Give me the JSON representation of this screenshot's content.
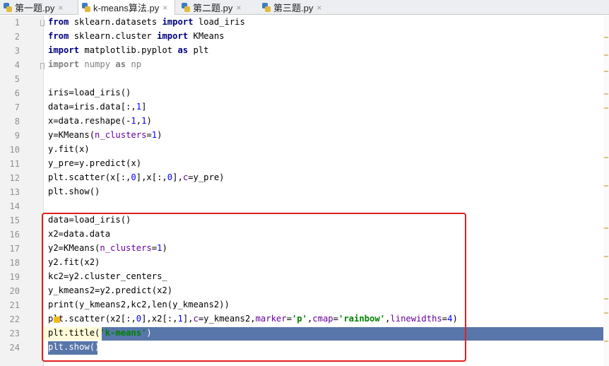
{
  "tabs": [
    {
      "label": "第一题.py",
      "active": false
    },
    {
      "label": "k-means算法.py",
      "active": true
    },
    {
      "label": "第二题.py",
      "active": false
    },
    {
      "label": "第三题.py",
      "active": false
    }
  ],
  "close_glyph": "×",
  "line_numbers": [
    "1",
    "2",
    "3",
    "4",
    "5",
    "6",
    "7",
    "8",
    "9",
    "10",
    "11",
    "12",
    "13",
    "14",
    "15",
    "16",
    "17",
    "18",
    "19",
    "20",
    "21",
    "22",
    "23",
    "24"
  ],
  "code": {
    "l1": [
      "from",
      " sklearn.datasets ",
      "import",
      " load_iris"
    ],
    "l2": [
      "from",
      " sklearn.cluster ",
      "import",
      " KMeans"
    ],
    "l3": [
      "import",
      " matplotlib.pyplot ",
      "as",
      " plt"
    ],
    "l4": [
      "import",
      " numpy ",
      "as",
      " np"
    ],
    "l6": "iris=load_iris()",
    "l7": [
      "data=iris.data[:,",
      "1",
      "]"
    ],
    "l8": [
      "x=data.reshape(-",
      "1",
      ",",
      "1",
      ")"
    ],
    "l9": [
      "y=KMeans(",
      "n_clusters",
      "=",
      "1",
      ")"
    ],
    "l10": "y.fit(x)",
    "l11": "y_pre=y.predict(x)",
    "l12": [
      "plt.scatter(x[:,",
      "0",
      "],x[:,",
      "0",
      "],",
      "c",
      "=y_pre)"
    ],
    "l13": "plt.show()",
    "l15": "data=load_iris()",
    "l16": "x2=data.data",
    "l17": [
      "y2=KMeans(",
      "n_clusters",
      "=",
      "1",
      ")"
    ],
    "l18": "y2.fit(x2)",
    "l19": "kc2=y2.cluster_centers_",
    "l20": "y_kmeans2=y2.predict(x2)",
    "l21": "print(y_kmeans2,kc2,len(y_kmeans2))",
    "l22": [
      "pl",
      "t.scatter(x2[:,",
      "0",
      "],x2[:,",
      "1",
      "],",
      "c",
      "=y_kmeans2,",
      "marker",
      "=",
      "'p'",
      ",",
      "cmap",
      "=",
      "'rainbow'",
      ",",
      "linewidths",
      "=",
      "4",
      ")"
    ],
    "l23": [
      "plt.title(",
      "'k-means'",
      ")"
    ],
    "l24": "plt.show()"
  }
}
